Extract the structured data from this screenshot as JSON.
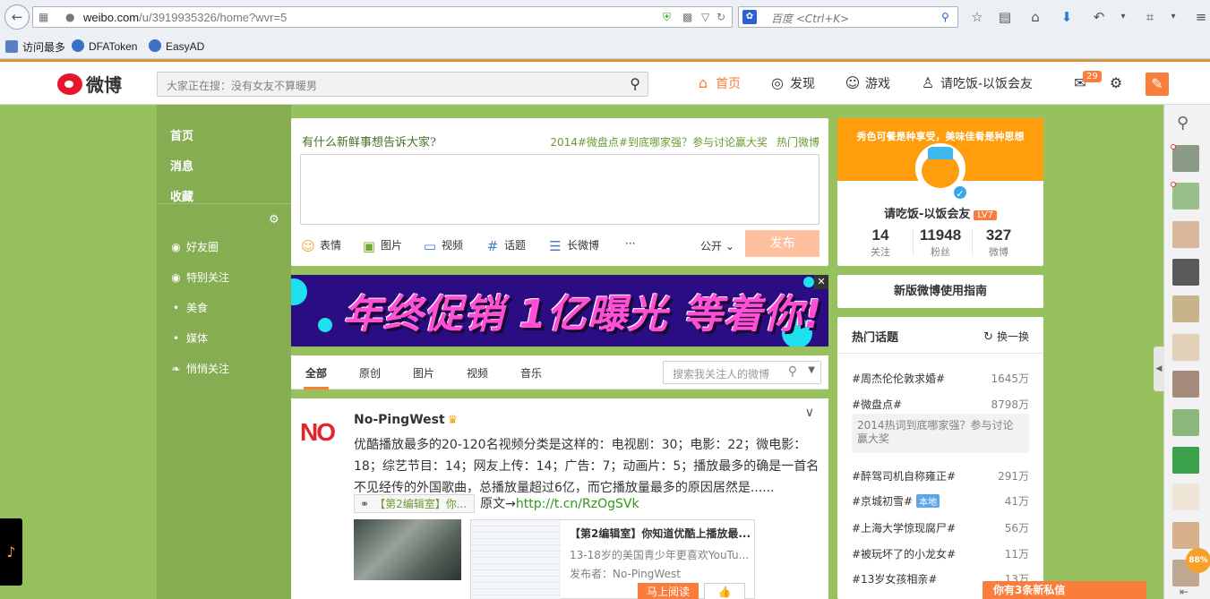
{
  "browser": {
    "url_host": "weibo.com",
    "url_path": "/u/3919935326/home?wvr=5",
    "search_engine": "百度",
    "search_placeholder": "百度 <Ctrl+K>",
    "bookmarks": [
      "访问最多",
      "DFAToken",
      "EasyAD"
    ]
  },
  "weibo": {
    "logo_text": "微博",
    "search_placeholder": "大家正在搜：没有女友不算暖男",
    "nav": [
      {
        "label": "首页",
        "icon": "home-icon",
        "active": true
      },
      {
        "label": "发现",
        "icon": "compass-icon",
        "active": false
      },
      {
        "label": "游戏",
        "icon": "gamepad-icon",
        "active": false
      },
      {
        "label": "请吃饭-以饭会友",
        "icon": "user-icon",
        "active": false
      }
    ],
    "message_badge": "29",
    "accent_color": "#fa7d3c",
    "background_color": "#97c15c"
  },
  "sidebar": {
    "main": [
      "首页",
      "消息",
      "收藏"
    ],
    "groups": [
      {
        "label": "好友圈",
        "icon": "circle-eye-icon"
      },
      {
        "label": "特别关注",
        "icon": "circle-star-icon"
      },
      {
        "label": "美食",
        "icon": "dot-icon"
      },
      {
        "label": "媒体",
        "icon": "dot-icon"
      },
      {
        "label": "悄悄关注",
        "icon": "leaf-icon"
      }
    ]
  },
  "publisher": {
    "title": "有什么新鲜事想告诉大家?",
    "topic_link": "2014#微盘点#到底哪家强？参与讨论赢大奖",
    "hot_link": "热门微博",
    "tools": [
      {
        "label": "表情",
        "icon": "smile-icon"
      },
      {
        "label": "图片",
        "icon": "image-icon"
      },
      {
        "label": "视频",
        "icon": "video-icon"
      },
      {
        "label": "话题",
        "icon": "hash-icon"
      },
      {
        "label": "长微博",
        "icon": "long-post-icon"
      }
    ],
    "more": "···",
    "visibility": "公开",
    "submit": "发布"
  },
  "ad": {
    "text": "年终促销 1亿曝光 等着你!",
    "close": "✕"
  },
  "feed_tabs": {
    "tabs": [
      "全部",
      "原创",
      "图片",
      "视频",
      "音乐"
    ],
    "active": "全部",
    "search_placeholder": "搜索我关注人的微博"
  },
  "post": {
    "author": "No-PingWest",
    "avatar_text": "NO",
    "text": "优酷播放最多的20-120名视频分类是这样的：电视剧：30；电影：22；微电影：18；综艺节目：14；网友上传：14；广告：7；动画片：5；播放最多的确是一首名不见经传的外国歌曲，总播放量超过6亿，而它播放量最多的原因居然是......",
    "link_card": "【第2编辑室】你...",
    "source_prefix": "原文→",
    "url": "http://t.cn/RzOgSVk",
    "share": {
      "title": "【第2编辑室】你知道优酷上播放最...",
      "desc": "13-18岁的美国青少年更喜欢YouTu...",
      "publisher": "发布者：No-PingWest",
      "read_button": "马上阅读"
    }
  },
  "profile": {
    "slogan": "秀色可餐是种享受，美味佳肴是种思想",
    "name": "请吃饭-以饭会友",
    "level": "LV7",
    "stats": [
      {
        "value": "14",
        "label": "关注"
      },
      {
        "value": "11948",
        "label": "粉丝"
      },
      {
        "value": "327",
        "label": "微博"
      }
    ]
  },
  "guide": "新版微博使用指南",
  "hot_topics": {
    "title": "热门话题",
    "refresh": "换一换",
    "items": [
      {
        "name": "#周杰伦伦敦求婚#",
        "count": "1645万"
      },
      {
        "name": "#微盘点#",
        "count": "8798万"
      },
      {
        "name": "#醉驾司机自称雍正#",
        "count": "291万"
      },
      {
        "name": "#京城初雪#",
        "count": "41万",
        "tag": "本地"
      },
      {
        "name": "#上海大学惊现腐尸#",
        "count": "56万"
      },
      {
        "name": "#被玩坏了的小龙女#",
        "count": "11万"
      },
      {
        "name": "#13岁女孩相亲#",
        "count": "13万"
      }
    ],
    "sub_text": "2014热词到底哪家强？参与讨论赢大奖"
  },
  "private_message_bar": "你有3条新私信",
  "rail": {
    "percent": "88%"
  }
}
